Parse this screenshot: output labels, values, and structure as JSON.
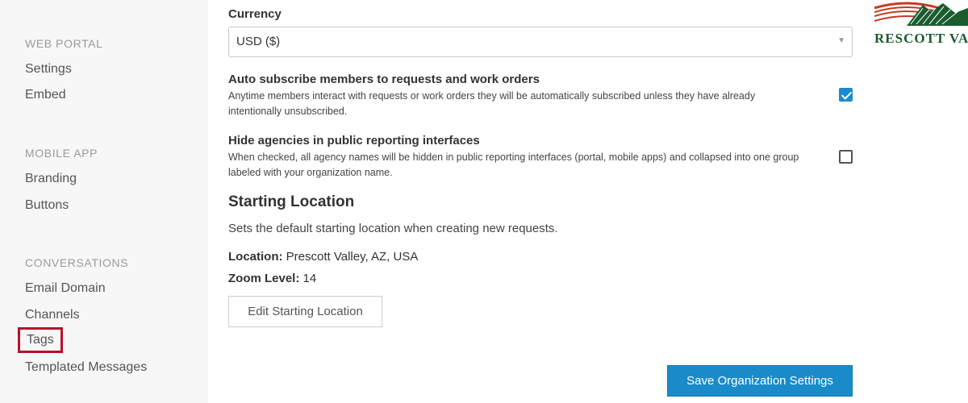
{
  "sidebar": {
    "sections": [
      {
        "heading": "WEB PORTAL",
        "items": [
          "Settings",
          "Embed"
        ]
      },
      {
        "heading": "MOBILE APP",
        "items": [
          "Branding",
          "Buttons"
        ]
      },
      {
        "heading": "CONVERSATIONS",
        "items": [
          "Email Domain",
          "Channels",
          "Tags",
          "Templated Messages"
        ]
      }
    ]
  },
  "currency": {
    "label": "Currency",
    "selected": "USD ($)"
  },
  "auto_subscribe": {
    "title": "Auto subscribe members to requests and work orders",
    "description": "Anytime members interact with requests or work orders they will be automatically subscribed unless they have already intentionally unsubscribed.",
    "checked": true
  },
  "hide_agencies": {
    "title": "Hide agencies in public reporting interfaces",
    "description": "When checked, all agency names will be hidden in public reporting interfaces (portal, mobile apps) and collapsed into one group labeled with your organization name.",
    "checked": false
  },
  "starting_location": {
    "title": "Starting Location",
    "description": "Sets the default starting location when creating new requests.",
    "location_label": "Location:",
    "location_value": "Prescott Valley, AZ, USA",
    "zoom_label": "Zoom Level:",
    "zoom_value": "14",
    "edit_button": "Edit Starting Location"
  },
  "save_button": "Save Organization Settings",
  "logo": {
    "text": "RESCOTT VAL"
  },
  "colors": {
    "accent": "#1a8bc9",
    "highlight_box": "#b8102a"
  }
}
